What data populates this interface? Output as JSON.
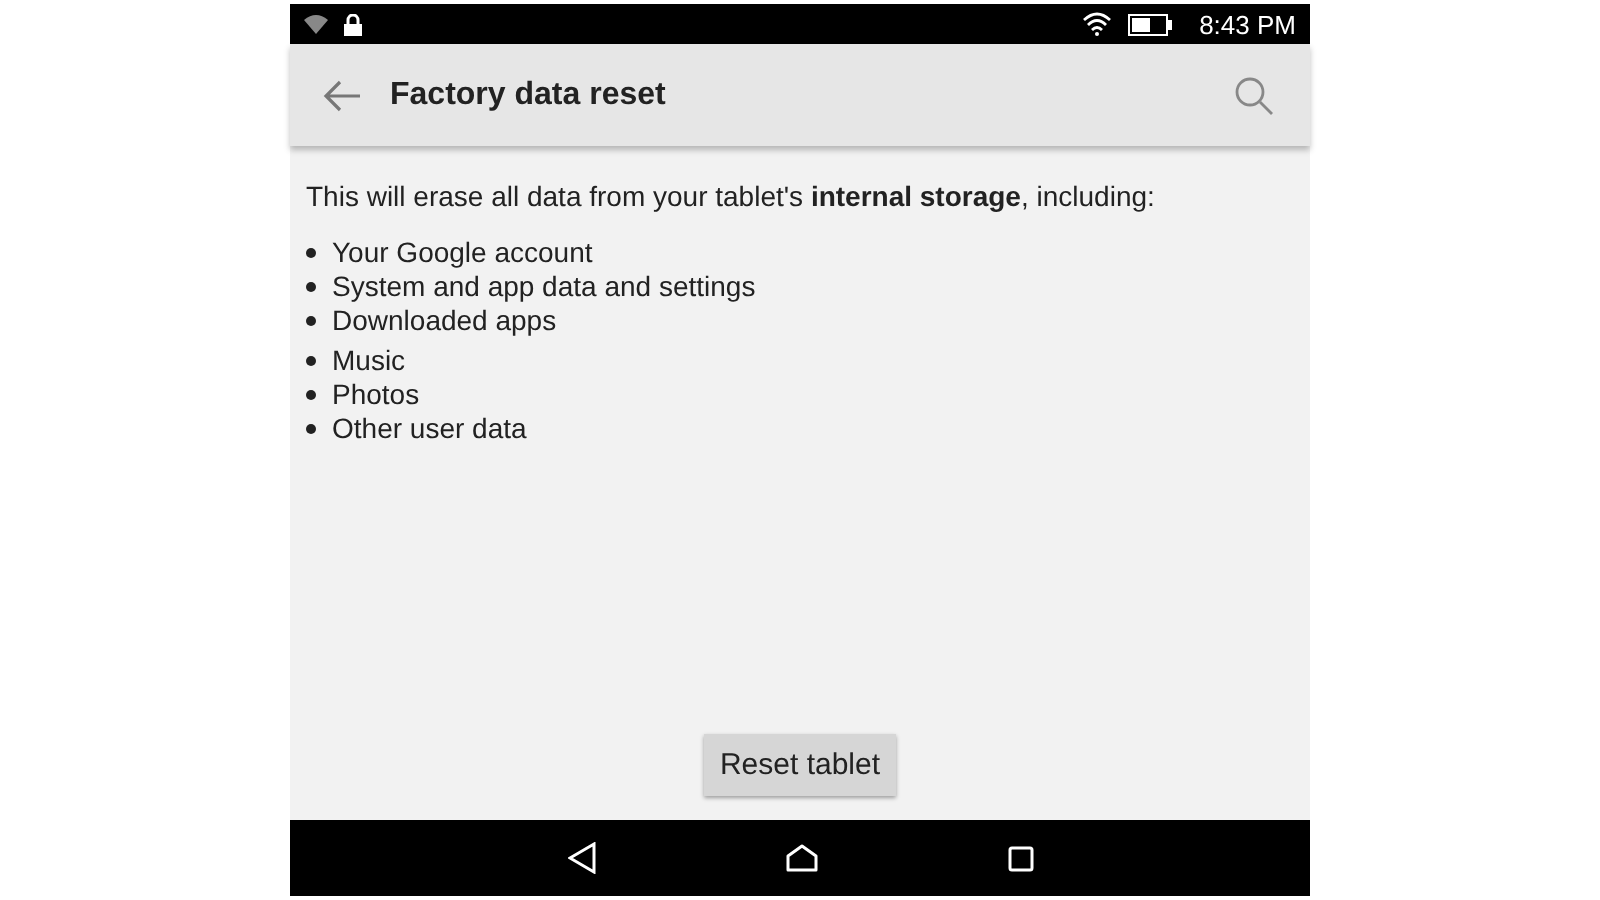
{
  "status_bar": {
    "time": "8:43 PM"
  },
  "app_bar": {
    "title": "Factory data reset"
  },
  "intro": "This will erase all data from your tablet's **internal storage**, including:",
  "item_groups": [
    [
      "Your Google account",
      "System and app data and settings",
      "Downloaded apps"
    ],
    [
      "Music",
      "Photos",
      "Other user data"
    ]
  ],
  "button": "Reset tablet"
}
